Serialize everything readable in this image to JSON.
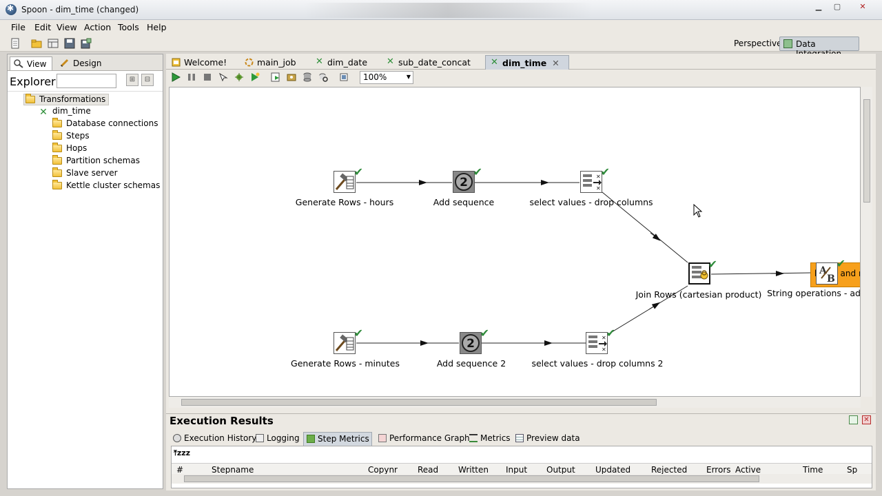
{
  "window": {
    "title": "Spoon - dim_time (changed)"
  },
  "menu": [
    "File",
    "Edit",
    "View",
    "Action",
    "Tools",
    "Help"
  ],
  "perspective": {
    "label": "Perspective:",
    "button": "Data Integration"
  },
  "left_tabs": {
    "view": "View",
    "design": "Design"
  },
  "explorer": {
    "label": "Explorer",
    "search_value": ""
  },
  "tree": {
    "root": "Transformations",
    "transformation": "dim_time",
    "children": [
      "Database connections",
      "Steps",
      "Hops",
      "Partition schemas",
      "Slave server",
      "Kettle cluster schemas"
    ]
  },
  "tabs": [
    "Welcome!",
    "main_job",
    "dim_date",
    "sub_date_concat",
    "dim_time"
  ],
  "active_tab": "dim_time",
  "zoom": "100%",
  "steps": {
    "gen_hours": "Generate Rows - hours",
    "add_seq": "Add sequence",
    "sel_drop": "select values - drop columns",
    "gen_minutes": "Generate Rows - minutes",
    "add_seq2": "Add sequence 2",
    "sel_drop2": "select values - drop columns 2",
    "join": "Join Rows (cartesian product)",
    "string_ops": "String operations - add",
    "note": "hours and m"
  },
  "exec": {
    "title": "Execution Results",
    "tabs": [
      "Execution History",
      "Logging",
      "Step Metrics",
      "Performance Graph",
      "Metrics",
      "Preview data"
    ],
    "active_tab": "Step Metrics",
    "columns": [
      "#",
      "Stepname",
      "Copynr",
      "Read",
      "Written",
      "Input",
      "Output",
      "Updated",
      "Rejected",
      "Errors",
      "Active",
      "Time",
      "Sp"
    ]
  }
}
